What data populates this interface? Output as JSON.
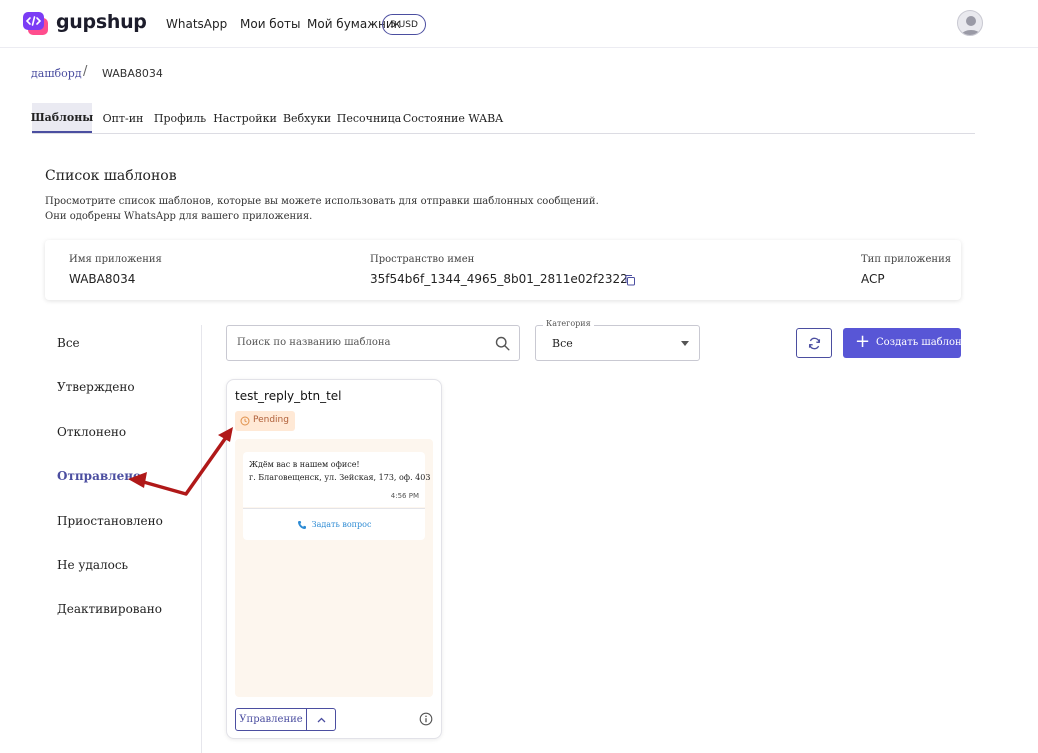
{
  "header": {
    "brand": "gupshup",
    "nav": [
      "WhatsApp",
      "Мои боты",
      "Мой бумажник"
    ],
    "wallet_badge": "5 USD",
    "accent_color": "#4b4ea0",
    "icons": {
      "logo": "chat-code-logo",
      "avatar": "user-avatar-icon"
    }
  },
  "breadcrumb": {
    "link": "дашборд",
    "separator": "/",
    "current": "WABA8034"
  },
  "tabs": [
    {
      "label": "Шаблоны",
      "active": true
    },
    {
      "label": "Опт-ин",
      "active": false
    },
    {
      "label": "Профиль",
      "active": false
    },
    {
      "label": "Настройки",
      "active": false
    },
    {
      "label": "Вебхуки",
      "active": false
    },
    {
      "label": "Песочница",
      "active": false
    },
    {
      "label": "Состояние WABA",
      "active": false
    }
  ],
  "section": {
    "title": "Список шаблонов",
    "desc_line1": "Просмотрите список шаблонов, которые вы можете использовать для отправки шаблонных сообщений.",
    "desc_line2": "Они одобрены WhatsApp для вашего приложения."
  },
  "app_info": {
    "app_name_label": "Имя приложения",
    "app_name": "WABA8034",
    "namespace_label": "Пространство имен",
    "namespace": "35f54b6f_1344_4965_8b01_2811e02f2322",
    "app_type_label": "Тип приложения",
    "app_type": "ACP"
  },
  "filters": [
    {
      "label": "Все",
      "active": false
    },
    {
      "label": "Утверждено",
      "active": false
    },
    {
      "label": "Отклонено",
      "active": false
    },
    {
      "label": "Отправлено",
      "active": true
    },
    {
      "label": "Приостановлено",
      "active": false
    },
    {
      "label": "Не удалось",
      "active": false
    },
    {
      "label": "Деактивировано",
      "active": false
    }
  ],
  "toolbar": {
    "search_placeholder": "Поиск по названию шаблона",
    "category_label": "Категория",
    "category_value": "Все",
    "create_label": "Создать шаблон",
    "primary_color": "#5856d6"
  },
  "template_card": {
    "name": "test_reply_btn_tel",
    "status": "Pending",
    "status_color": "#ffe9d6",
    "message_line1": "Ждём вас в нашем офисе!",
    "message_line2": "г. Благовещенск, ул. Зейская, 173, оф. 403",
    "time": "4:56 PM",
    "button_label": "Задать вопрос",
    "manage_label": "Управление"
  },
  "annotation": {
    "arrow_color": "#b01818"
  }
}
